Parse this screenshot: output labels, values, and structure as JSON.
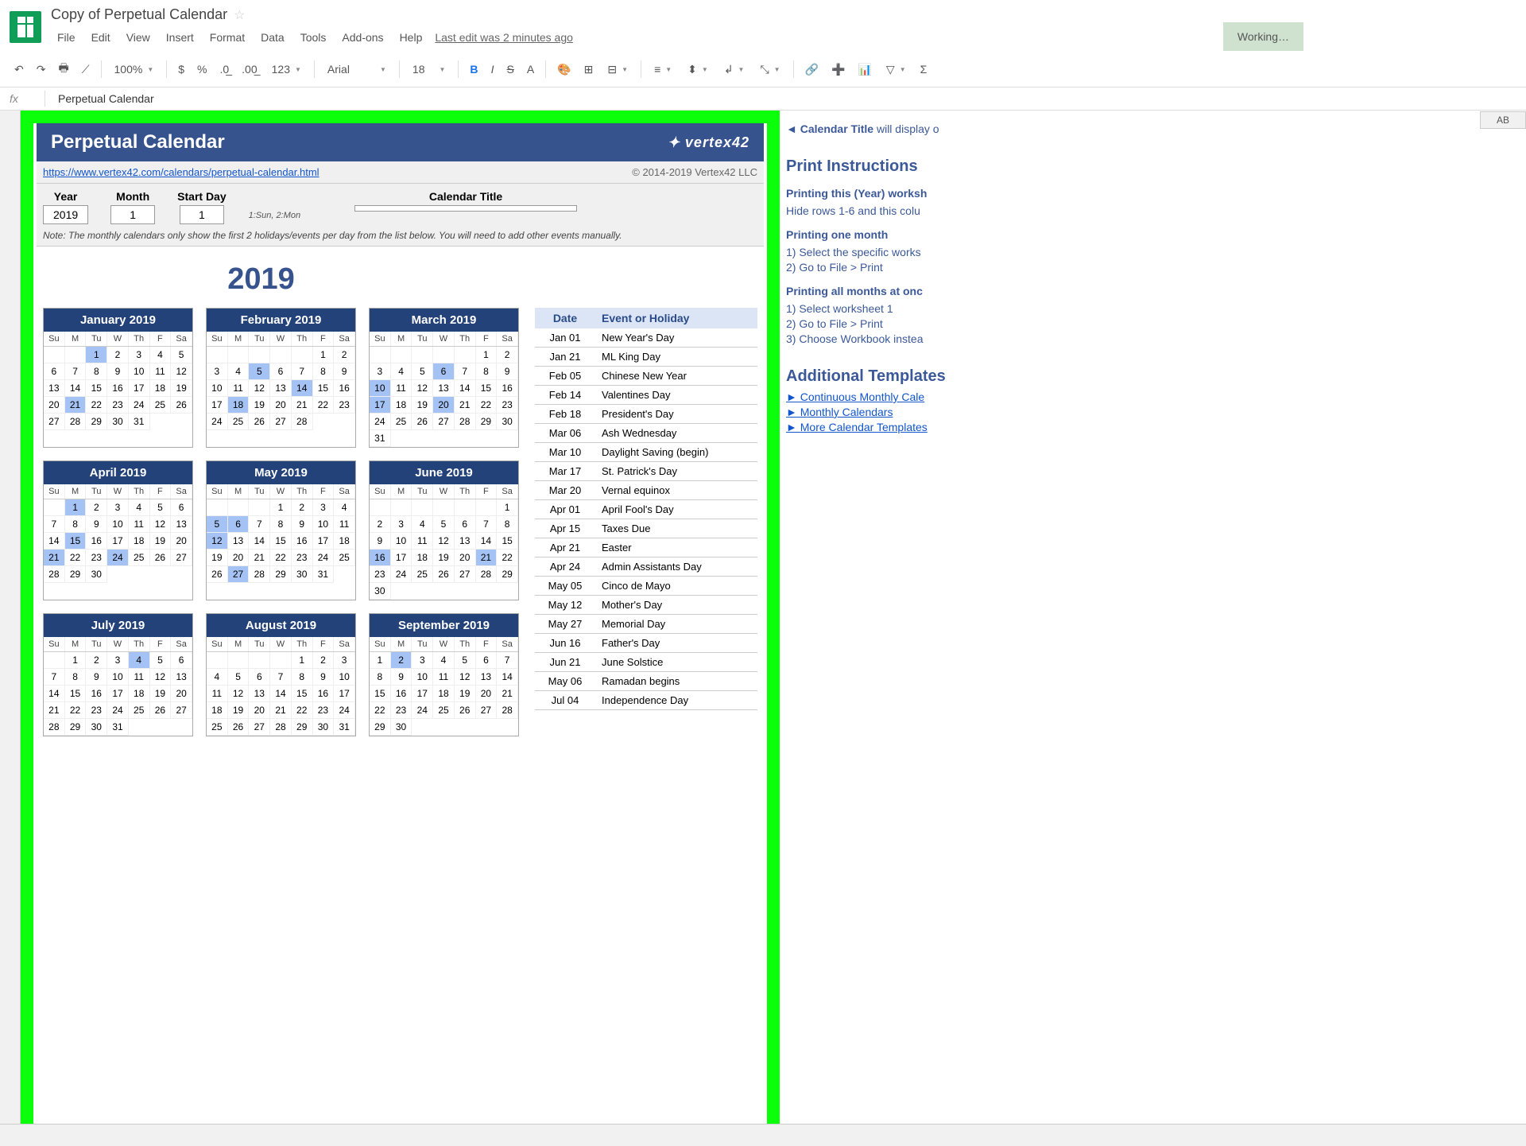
{
  "doc_title": "Copy of Perpetual Calendar",
  "menus": [
    "File",
    "Edit",
    "View",
    "Insert",
    "Format",
    "Data",
    "Tools",
    "Add-ons",
    "Help"
  ],
  "last_edit": "Last edit was 2 minutes ago",
  "working": "Working…",
  "toolbar": {
    "zoom": "100%",
    "font": "Arial",
    "font_size": "18"
  },
  "formula": {
    "fx": "fx",
    "content": "Perpetual Calendar"
  },
  "calendar": {
    "title": "Perpetual Calendar",
    "brand": "vertex42",
    "url": "https://www.vertex42.com/calendars/perpetual-calendar.html",
    "copyright": "© 2014-2019 Vertex42 LLC",
    "inputs": {
      "year_label": "Year",
      "year": "2019",
      "month_label": "Month",
      "month": "1",
      "startday_label": "Start Day",
      "startday": "1",
      "startday_help": "1:Sun, 2:Mon",
      "caltitle_label": "Calendar Title",
      "caltitle": ""
    },
    "note": "Note: The monthly calendars only show the first 2 holidays/events per day from the list below. You will need to add other events manually.",
    "year_title": "2019",
    "weekdays": [
      "Su",
      "M",
      "Tu",
      "W",
      "Th",
      "F",
      "Sa"
    ],
    "months": [
      {
        "name": "January 2019",
        "lead": 2,
        "days": 31,
        "hl": [
          1,
          21
        ]
      },
      {
        "name": "February 2019",
        "lead": 5,
        "days": 28,
        "hl": [
          5,
          14,
          18
        ]
      },
      {
        "name": "March 2019",
        "lead": 5,
        "days": 31,
        "hl": [
          6,
          10,
          17,
          20
        ]
      },
      {
        "name": "April 2019",
        "lead": 1,
        "days": 30,
        "hl": [
          1,
          15,
          21,
          24
        ]
      },
      {
        "name": "May 2019",
        "lead": 3,
        "days": 31,
        "hl": [
          5,
          6,
          12,
          27
        ]
      },
      {
        "name": "June 2019",
        "lead": 6,
        "days": 30,
        "hl": [
          16,
          21
        ]
      },
      {
        "name": "July 2019",
        "lead": 1,
        "days": 31,
        "hl": [
          4
        ]
      },
      {
        "name": "August 2019",
        "lead": 4,
        "days": 31,
        "hl": []
      },
      {
        "name": "September 2019",
        "lead": 0,
        "days": 30,
        "hl": [
          2
        ]
      }
    ],
    "events_header": {
      "date": "Date",
      "event": "Event or Holiday"
    },
    "events": [
      {
        "d": "Jan 01",
        "e": "New Year's Day"
      },
      {
        "d": "Jan 21",
        "e": "ML King Day"
      },
      {
        "d": "Feb 05",
        "e": "Chinese New Year"
      },
      {
        "d": "Feb 14",
        "e": "Valentines Day"
      },
      {
        "d": "Feb 18",
        "e": "President's Day"
      },
      {
        "d": "Mar 06",
        "e": "Ash Wednesday"
      },
      {
        "d": "Mar 10",
        "e": "Daylight Saving (begin)"
      },
      {
        "d": "Mar 17",
        "e": "St. Patrick's Day"
      },
      {
        "d": "Mar 20",
        "e": "Vernal equinox"
      },
      {
        "d": "Apr 01",
        "e": "April Fool's Day"
      },
      {
        "d": "Apr 15",
        "e": "Taxes Due"
      },
      {
        "d": "Apr 21",
        "e": "Easter"
      },
      {
        "d": "Apr 24",
        "e": "Admin Assistants Day"
      },
      {
        "d": "May 05",
        "e": "Cinco de Mayo"
      },
      {
        "d": "May 12",
        "e": "Mother's Day"
      },
      {
        "d": "May 27",
        "e": "Memorial Day"
      },
      {
        "d": "Jun 16",
        "e": "Father's Day"
      },
      {
        "d": "Jun 21",
        "e": "June Solstice"
      },
      {
        "d": "May 06",
        "e": "Ramadan begins"
      },
      {
        "d": "Jul 04",
        "e": "Independence Day"
      }
    ]
  },
  "sidebar": {
    "cal_title_note_prefix": "◄ Calendar Title",
    "cal_title_note_suffix": " will display o",
    "print_title": "Print Instructions",
    "print_sub1": "Printing this (Year) worksh",
    "print_line1": "Hide rows 1-6 and this colu",
    "print_sub2": "Printing one month",
    "print_line2a": "1) Select the specific works",
    "print_line2b": "2) Go to File > Print",
    "print_sub3": "Printing all months at onc",
    "print_line3a": "1) Select worksheet 1",
    "print_line3b": "2) Go to File > Print",
    "print_line3c": "3) Choose Workbook instea",
    "add_title": "Additional Templates",
    "add1": "► Continuous Monthly Cale",
    "add2": "► Monthly Calendars",
    "add3": "► More Calendar Templates"
  },
  "col_header": "AB"
}
